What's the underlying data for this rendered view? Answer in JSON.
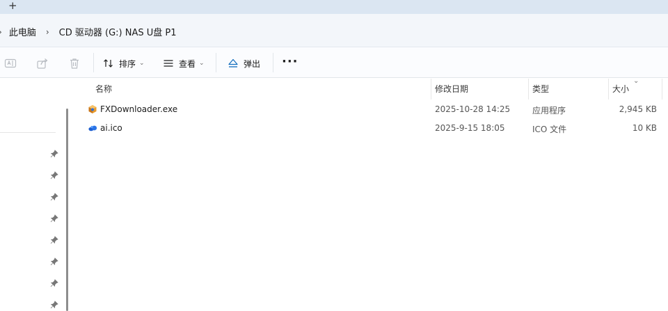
{
  "tabbar": {
    "new_tab": "+"
  },
  "breadcrumb": {
    "separator": "›",
    "items": [
      "此电脑",
      "CD 驱动器 (G:) NAS U盘 P1"
    ]
  },
  "toolbar": {
    "sort_label": "排序",
    "view_label": "查看",
    "eject_label": "弹出",
    "more_label": "···",
    "chevron": "⌄"
  },
  "columns": {
    "name": "名称",
    "modified": "修改日期",
    "type": "类型",
    "size": "大小",
    "sort_indicator": "⌄"
  },
  "files": [
    {
      "name": "FXDownloader.exe",
      "modified": "2025-10-28 14:25",
      "type": "应用程序",
      "size": "2,945 KB",
      "icon": "app-exe-icon"
    },
    {
      "name": "ai.ico",
      "modified": "2025-9-15 18:05",
      "type": "ICO 文件",
      "size": "10 KB",
      "icon": "ico-file-icon"
    }
  ],
  "colors": {
    "accent": "#0f6cbd",
    "tab_bg": "#dbe6f2",
    "address_bg": "#f3f6fa"
  }
}
